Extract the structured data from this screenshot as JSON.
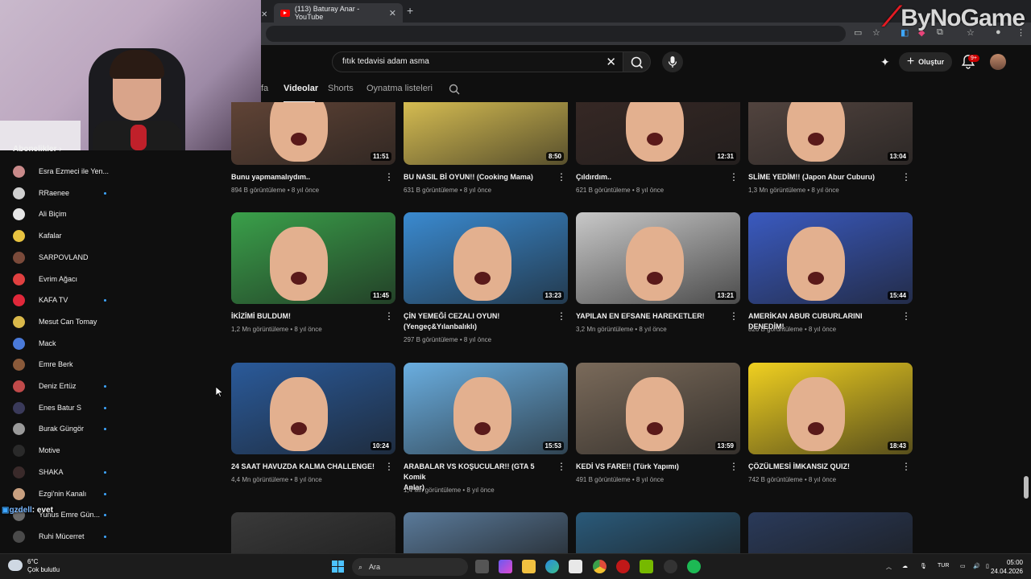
{
  "browser": {
    "active_tab_title": "(113) Baturay Anar - YouTube",
    "new_tab_symbol": "+",
    "close_symbol": "✕"
  },
  "watermark": {
    "text": "ByNoGame"
  },
  "sidebar": {
    "section_title": "Abonelikler",
    "items": [
      {
        "label": "Esra Ezmeci ile Yen...",
        "dot": false,
        "color": "#c98a8a"
      },
      {
        "label": "RRaenee",
        "dot": true,
        "color": "#d0d0d0"
      },
      {
        "label": "Ali Biçim",
        "dot": false,
        "color": "#e6e6e6"
      },
      {
        "label": "Kafalar",
        "dot": false,
        "color": "#e8c340"
      },
      {
        "label": "SARPOVLAND",
        "dot": false,
        "color": "#7a4a3a"
      },
      {
        "label": "Evrim Ağacı",
        "dot": false,
        "color": "#e04040"
      },
      {
        "label": "KAFA TV",
        "dot": true,
        "color": "#e0283a"
      },
      {
        "label": "Mesut Can Tomay",
        "dot": false,
        "color": "#d9b84a"
      },
      {
        "label": "Mack",
        "dot": false,
        "color": "#4a7ad9"
      },
      {
        "label": "Emre Berk",
        "dot": false,
        "color": "#8a5a3a"
      },
      {
        "label": "Deniz Ertüz",
        "dot": true,
        "color": "#c04a4a"
      },
      {
        "label": "Enes Batur S",
        "dot": true,
        "color": "#3a3a5a"
      },
      {
        "label": "Burak Güngör",
        "dot": true,
        "color": "#9a9a9a"
      },
      {
        "label": "Motive",
        "dot": false,
        "color": "#2a2a2a"
      },
      {
        "label": "SHAKA",
        "dot": true,
        "color": "#3a2a2a"
      },
      {
        "label": "Ezgi'nin Kanalı",
        "dot": true,
        "color": "#c8a080"
      },
      {
        "label": "Yunus Emre Gün...",
        "dot": true,
        "color": "#6a6a6a"
      },
      {
        "label": "Ruhi Mücerret",
        "dot": true,
        "color": "#4a4a4a"
      }
    ]
  },
  "chat_overlay": {
    "user": "gzdell",
    "message": ": evet"
  },
  "topbar": {
    "search_value": "fıtık tedavisi adam asma",
    "create_label": "Oluştur",
    "notification_count": "9+"
  },
  "channel_tabs": {
    "partial": "fa",
    "videos": "Videolar",
    "shorts": "Shorts",
    "playlists": "Oynatma listeleri"
  },
  "videos": [
    {
      "title": "Bunu yapmamalıydım..",
      "title2": "",
      "views": "894 B görüntüleme",
      "age": "8 yıl önce",
      "duration": "11:51",
      "bg": "#6b4a3a",
      "face": true
    },
    {
      "title": "BU NASIL Bİ OYUN!! (Cooking Mama)",
      "title2": "",
      "views": "631 B görüntüleme",
      "age": "8 yıl önce",
      "duration": "8:50",
      "bg": "#f2d55a",
      "face": false
    },
    {
      "title": "Çıldırdım..",
      "title2": "",
      "views": "621 B görüntüleme",
      "age": "8 yıl önce",
      "duration": "12:31",
      "bg": "#3a2a26",
      "face": true
    },
    {
      "title": "SLİME YEDİM!! (Japon Abur Cuburu)",
      "title2": "",
      "views": "1,3 Mn görüntüleme",
      "age": "8 yıl önce",
      "duration": "13:04",
      "bg": "#5a4a44",
      "face": true
    },
    {
      "title": "İKİZİMİ BULDUM!",
      "title2": "",
      "views": "1,2 Mn görüntüleme",
      "age": "8 yıl önce",
      "duration": "11:45",
      "bg": "#3aa04a",
      "face": true
    },
    {
      "title": "ÇİN YEMEĞİ CEZALI OYUN!",
      "title2": "(Yengeç&Yılanbalıklı)",
      "views": "297 B görüntüleme",
      "age": "8 yıl önce",
      "duration": "13:23",
      "bg": "#3a8ad0",
      "face": true
    },
    {
      "title": "YAPILAN EN EFSANE HAREKETLER!",
      "title2": "",
      "views": "3,2 Mn görüntüleme",
      "age": "8 yıl önce",
      "duration": "13:21",
      "bg": "#c8c8c8",
      "face": true
    },
    {
      "title": "AMERİKAN ABUR CUBURLARINI DENEDİM!",
      "title2": "",
      "views": "826 B görüntüleme",
      "age": "8 yıl önce",
      "duration": "15:44",
      "bg": "#3a5ac0",
      "face": true
    },
    {
      "title": "24 SAAT HAVUZDA KALMA CHALLENGE!",
      "title2": "",
      "views": "4,4 Mn görüntüleme",
      "age": "8 yıl önce",
      "duration": "10:24",
      "bg": "#2a5a9a",
      "face": true
    },
    {
      "title": "ARABALAR VS KOŞUCULAR!! (GTA 5 Komik",
      "title2": "Anlar)",
      "views": "1,4 Mn görüntüleme",
      "age": "8 yıl önce",
      "duration": "15:53",
      "bg": "#6aaee0",
      "face": true
    },
    {
      "title": "KEDİ VS FARE!! (Türk Yapımı)",
      "title2": "",
      "views": "491 B görüntüleme",
      "age": "8 yıl önce",
      "duration": "13:59",
      "bg": "#7a6a5a",
      "face": true
    },
    {
      "title": "ÇÖZÜLMESİ İMKANSIZ QUIZ!",
      "title2": "",
      "views": "742 B görüntüleme",
      "age": "8 yıl önce",
      "duration": "18:43",
      "bg": "#f0d020",
      "face": true
    },
    {
      "title": "",
      "title2": "",
      "views": "",
      "age": "",
      "duration": "",
      "bg": "#3a3a3a",
      "face": false
    },
    {
      "title": "",
      "title2": "",
      "views": "",
      "age": "",
      "duration": "",
      "bg": "#5a7a9a",
      "face": false
    },
    {
      "title": "",
      "title2": "",
      "views": "",
      "age": "",
      "duration": "",
      "bg": "#2a5a7a",
      "face": false
    },
    {
      "title": "",
      "title2": "",
      "views": "",
      "age": "",
      "duration": "",
      "bg": "#2a3a5a",
      "face": false
    }
  ],
  "taskbar": {
    "temperature": "6°C",
    "weather": "Çok bulutlu",
    "search_label": "Ara",
    "language": "TUR",
    "time": "05:00",
    "date": "24.04.2026"
  }
}
